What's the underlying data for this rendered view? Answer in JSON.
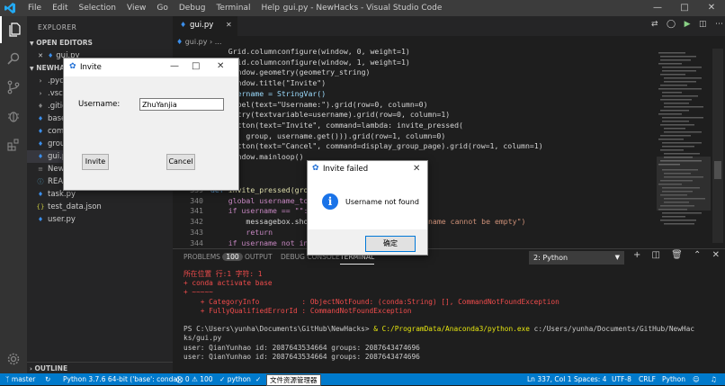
{
  "titlebar": {
    "menus": [
      "File",
      "Edit",
      "Selection",
      "View",
      "Go",
      "Debug",
      "Terminal",
      "Help"
    ],
    "title": "gui.py - NewHacks - Visual Studio Code"
  },
  "sidebar": {
    "header": "EXPLORER",
    "open_editors": "OPEN EDITORS",
    "open_file": "gui.py",
    "project": "NEWHA",
    "items": [
      ".pyc",
      ".vsco",
      ".gitig",
      "base.",
      "comm",
      "group",
      "gui.py",
      "NewH",
      "READ",
      "task.py",
      "test_data.json",
      "user.py"
    ],
    "outline": "OUTLINE"
  },
  "editor": {
    "tab": "gui.py",
    "breadcrumb": "gui.py  ›  ..."
  },
  "code": {
    "l1": "Grid.columnconfigure(window, 0, weight=1)",
    "l2": "Grid.columnconfigure(window, 1, weight=1)",
    "l3": "window.geometry(geometry_string)",
    "l4": "window.title(\"Invite\")",
    "l5": "username = StringVar()",
    "l6": "Label(text=\"Username:\").grid(row=0, column=0)",
    "l7": "Entry(textvariable=username).grid(row=0, column=1)",
    "l8": "Button(text=\"Invite\", command=lambda: invite_pressed(",
    "l9": "    group, username.get())).grid(row=1, column=0)",
    "l10": "Button(text=\"Cancel\", command=display_group_page).grid(row=1, column=1)",
    "l11": "window.mainloop()",
    "n339": "339",
    "l12a": "def ",
    "l12b": "invite_pressed(grou",
    "n340": "340",
    "l13": "    global username_to",
    "n341": "341",
    "l14": "    if username == \"\":",
    "n342": "342",
    "l15a": "        messagebox.sho",
    "l15b": "name cannot be empty\")",
    "n343": "343",
    "l16": "        return",
    "n344": "344",
    "l17": "    if username not in"
  },
  "panel": {
    "tabs": [
      "PROBLEMS",
      "OUTPUT",
      "DEBUG CONSOLE",
      "TERMINAL"
    ],
    "problems_count": "100",
    "terminal_select": "2: Python",
    "lines": {
      "t1": "所在位置 行:1 字符: 1",
      "t2": "+ conda activate base",
      "t3": "+ ~~~~~",
      "t4": "    + CategoryInfo          : ObjectNotFound: (conda:String) [], CommandNotFoundException",
      "t5": "    + FullyQualifiedErrorId : CommandNotFoundException",
      "t6a": "PS C:\\Users\\yunha\\Documents\\GitHub\\NewHacks> ",
      "t6b": "& ",
      "t6c": "C:/ProgramData/Anaconda3/python.exe",
      "t6d": " c:/Users/yunha/Documents/GitHub/NewHac",
      "t7": "ks/gui.py",
      "t8": "user: QianYunhao id: 2087643534664 groups: 2087643474696",
      "t9": "user: QianYunhao id: 2087643534664 groups: 2087643474696"
    }
  },
  "status": {
    "branch": "master",
    "python": "Python 3.7.6 64-bit ('base': conda)",
    "errors": "0",
    "warnings": "100",
    "lang_item": "python",
    "explorer": "文件资源管理器",
    "position": "Ln 337, Col 1",
    "spaces": "Spaces: 4",
    "encoding": "UTF-8",
    "eol": "CRLF",
    "language": "Python"
  },
  "invite_window": {
    "title": "Invite",
    "label": "Username:",
    "value": "ZhuYanjia",
    "invite_btn": "Invite",
    "cancel_btn": "Cancel"
  },
  "messagebox": {
    "title": "Invite failed",
    "message": "Username not found",
    "ok_btn": "确定"
  }
}
